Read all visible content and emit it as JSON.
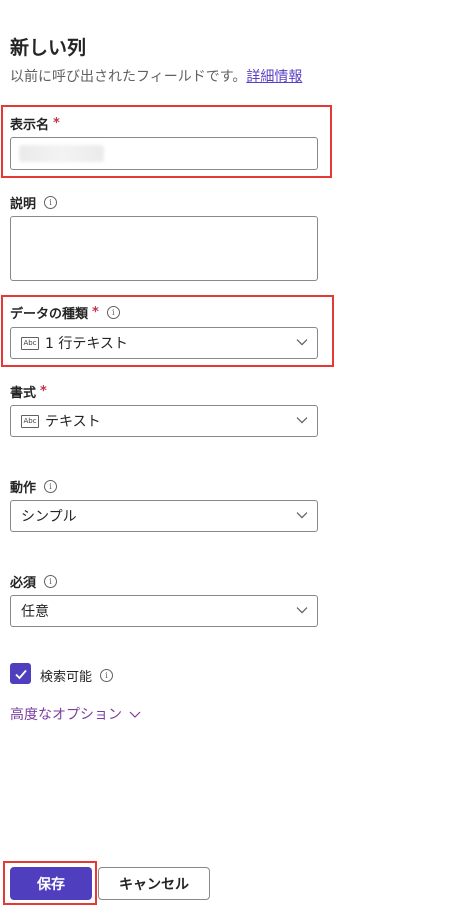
{
  "header": {
    "title": "新しい列",
    "subtitle": "以前に呼び出されたフィールドです。",
    "link": "詳細情報"
  },
  "fields": {
    "display_name": {
      "label": "表示名",
      "required": "*"
    },
    "description": {
      "label": "説明"
    },
    "data_type": {
      "label": "データの種類",
      "required": "*",
      "icon_text": "Abc",
      "value": "1 行テキスト"
    },
    "format": {
      "label": "書式",
      "required": "*",
      "icon_text": "Abc",
      "value": "テキスト"
    },
    "behavior": {
      "label": "動作",
      "value": "シンプル"
    },
    "required": {
      "label": "必須",
      "value": "任意"
    }
  },
  "searchable": {
    "label": "検索可能",
    "checked": true
  },
  "advanced": {
    "label": "高度なオプション"
  },
  "footer": {
    "save": "保存",
    "cancel": "キャンセル"
  },
  "colors": {
    "accent": "#4f3fbf",
    "highlight": "#e53935",
    "link": "#5b3fc4",
    "required": "#c4314b"
  }
}
